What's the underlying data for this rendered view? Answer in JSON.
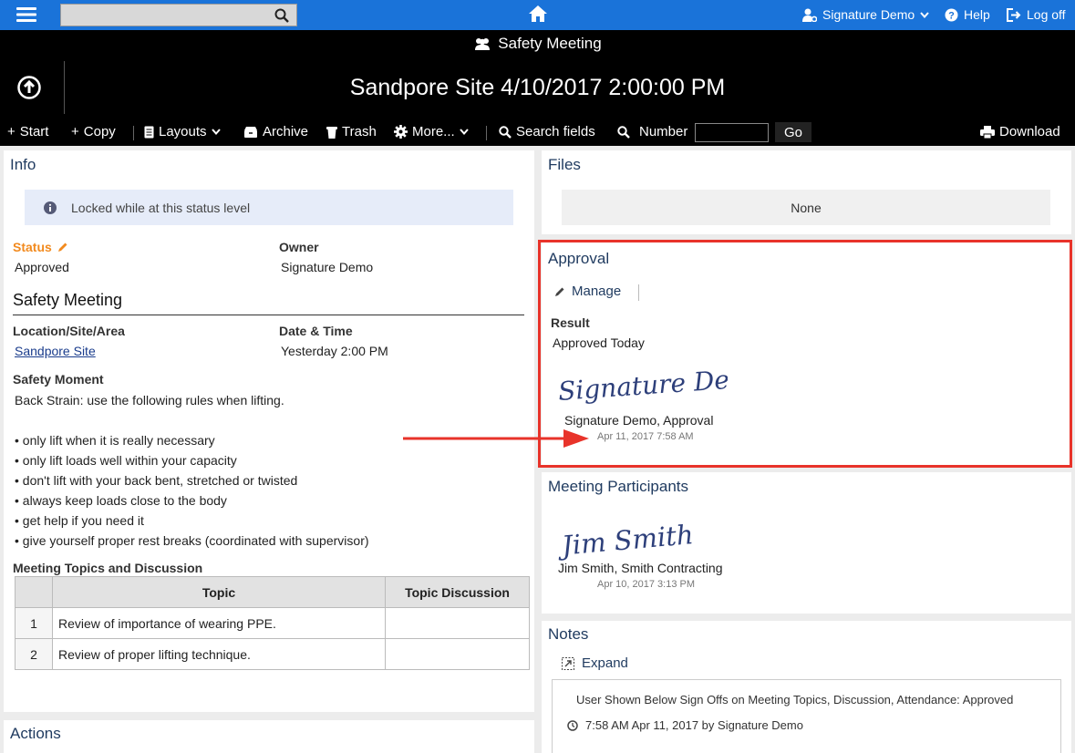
{
  "topbar": {
    "search_value": "",
    "user": "Signature Demo",
    "help": "Help",
    "logoff": "Log off"
  },
  "header": {
    "module": "Safety Meeting",
    "record_title": "Sandpore Site 4/10/2017 2:00:00 PM"
  },
  "toolbar": {
    "start": "Start",
    "copy": "Copy",
    "layouts": "Layouts",
    "archive": "Archive",
    "trash": "Trash",
    "more": "More...",
    "search_fields": "Search fields",
    "number": "Number",
    "number_value": "",
    "go": "Go",
    "download": "Download"
  },
  "info": {
    "title": "Info",
    "locked_msg": "Locked while at this status level",
    "status_label": "Status",
    "status_value": "Approved",
    "owner_label": "Owner",
    "owner_value": "Signature Demo",
    "section_title": "Safety Meeting",
    "location_label": "Location/Site/Area",
    "location_value": "Sandpore Site",
    "datetime_label": "Date & Time",
    "datetime_value": "Yesterday 2:00 PM",
    "moment_label": "Safety Moment",
    "moment_intro": "Back Strain: use the following rules when lifting.",
    "moment_items": [
      "• only lift when it is really necessary",
      "• only lift loads well within your capacity",
      "• don't lift with your back bent, stretched or twisted",
      "• always keep loads close to the body",
      "• get help if you need it",
      "• give yourself proper rest breaks (coordinated with supervisor)"
    ],
    "topics_label": "Meeting Topics and Discussion",
    "topics_headers": [
      "",
      "Topic",
      "Topic Discussion"
    ],
    "topics_rows": [
      {
        "num": "1",
        "topic": "Review of importance of wearing PPE.",
        "discussion": ""
      },
      {
        "num": "2",
        "topic": "Review of proper lifting technique.",
        "discussion": ""
      }
    ]
  },
  "files": {
    "title": "Files",
    "empty": "None"
  },
  "approval": {
    "title": "Approval",
    "manage": "Manage",
    "result_label": "Result",
    "result_value": "Approved Today",
    "signature_caption": "Signature Demo, Approval",
    "signature_date": "Apr 11, 2017 7:58 AM",
    "signature_script": "Signature Demo"
  },
  "participants": {
    "title": "Meeting Participants",
    "signature_caption": "Jim Smith, Smith Contracting",
    "signature_date": "Apr 10, 2017 3:13 PM",
    "signature_script": "Jim Smith"
  },
  "notes": {
    "title": "Notes",
    "expand": "Expand",
    "note_text": "User Shown Below Sign Offs on Meeting Topics, Discussion, Attendance: Approved",
    "note_meta": "7:58 AM Apr 11, 2017 by Signature Demo"
  },
  "actions": {
    "title": "Actions"
  },
  "colors": {
    "topbar": "#1a73d9",
    "header": "#000000",
    "highlight": "#e8332a",
    "status_label": "#f28a1e",
    "title_text": "#1f3a5f"
  }
}
